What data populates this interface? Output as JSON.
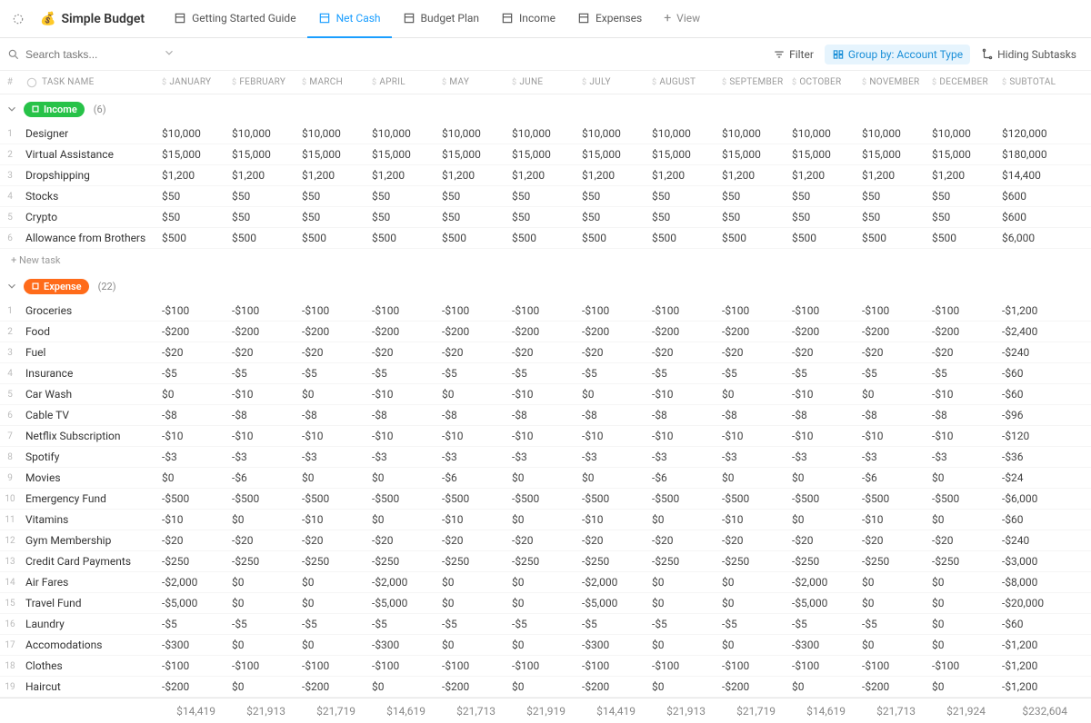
{
  "header": {
    "title": "Simple Budget",
    "emoji": "💰",
    "tabs": [
      {
        "label": "Getting Started Guide",
        "active": false
      },
      {
        "label": "Net Cash",
        "active": true
      },
      {
        "label": "Budget Plan",
        "active": false
      },
      {
        "label": "Income",
        "active": false
      },
      {
        "label": "Expenses",
        "active": false
      }
    ],
    "add_view_label": "View"
  },
  "toolbar": {
    "search_placeholder": "Search tasks...",
    "filter_label": "Filter",
    "group_label": "Group by: Account Type",
    "subtasks_label": "Hiding Subtasks"
  },
  "columns": {
    "index": "#",
    "name": "TASK NAME",
    "months": [
      "JANUARY",
      "FEBRUARY",
      "MARCH",
      "APRIL",
      "MAY",
      "JUNE",
      "JULY",
      "AUGUST",
      "SEPTEMBER",
      "OCTOBER",
      "NOVEMBER",
      "DECEMBER"
    ],
    "subtotal": "SUBTOTAL"
  },
  "groups": [
    {
      "name": "Income",
      "class": "income",
      "count": "(6)",
      "rows": [
        {
          "name": "Designer",
          "vals": [
            "$10,000",
            "$10,000",
            "$10,000",
            "$10,000",
            "$10,000",
            "$10,000",
            "$10,000",
            "$10,000",
            "$10,000",
            "$10,000",
            "$10,000",
            "$10,000"
          ],
          "sub": "$120,000"
        },
        {
          "name": "Virtual Assistance",
          "vals": [
            "$15,000",
            "$15,000",
            "$15,000",
            "$15,000",
            "$15,000",
            "$15,000",
            "$15,000",
            "$15,000",
            "$15,000",
            "$15,000",
            "$15,000",
            "$15,000"
          ],
          "sub": "$180,000"
        },
        {
          "name": "Dropshipping",
          "vals": [
            "$1,200",
            "$1,200",
            "$1,200",
            "$1,200",
            "$1,200",
            "$1,200",
            "$1,200",
            "$1,200",
            "$1,200",
            "$1,200",
            "$1,200",
            "$1,200"
          ],
          "sub": "$14,400"
        },
        {
          "name": "Stocks",
          "vals": [
            "$50",
            "$50",
            "$50",
            "$50",
            "$50",
            "$50",
            "$50",
            "$50",
            "$50",
            "$50",
            "$50",
            "$50"
          ],
          "sub": "$600"
        },
        {
          "name": "Crypto",
          "vals": [
            "$50",
            "$50",
            "$50",
            "$50",
            "$50",
            "$50",
            "$50",
            "$50",
            "$50",
            "$50",
            "$50",
            "$50"
          ],
          "sub": "$600"
        },
        {
          "name": "Allowance from Brothers",
          "vals": [
            "$500",
            "$500",
            "$500",
            "$500",
            "$500",
            "$500",
            "$500",
            "$500",
            "$500",
            "$500",
            "$500",
            "$500"
          ],
          "sub": "$6,000"
        }
      ]
    },
    {
      "name": "Expense",
      "class": "expense",
      "count": "(22)",
      "rows": [
        {
          "name": "Groceries",
          "vals": [
            "-$100",
            "-$100",
            "-$100",
            "-$100",
            "-$100",
            "-$100",
            "-$100",
            "-$100",
            "-$100",
            "-$100",
            "-$100",
            "-$100"
          ],
          "sub": "-$1,200"
        },
        {
          "name": "Food",
          "vals": [
            "-$200",
            "-$200",
            "-$200",
            "-$200",
            "-$200",
            "-$200",
            "-$200",
            "-$200",
            "-$200",
            "-$200",
            "-$200",
            "-$200"
          ],
          "sub": "-$2,400"
        },
        {
          "name": "Fuel",
          "vals": [
            "-$20",
            "-$20",
            "-$20",
            "-$20",
            "-$20",
            "-$20",
            "-$20",
            "-$20",
            "-$20",
            "-$20",
            "-$20",
            "-$20"
          ],
          "sub": "-$240"
        },
        {
          "name": "Insurance",
          "vals": [
            "-$5",
            "-$5",
            "-$5",
            "-$5",
            "-$5",
            "-$5",
            "-$5",
            "-$5",
            "-$5",
            "-$5",
            "-$5",
            "-$5"
          ],
          "sub": "-$60"
        },
        {
          "name": "Car Wash",
          "vals": [
            "$0",
            "-$10",
            "$0",
            "-$10",
            "$0",
            "-$10",
            "$0",
            "-$10",
            "$0",
            "-$10",
            "$0",
            "-$10"
          ],
          "sub": "-$60"
        },
        {
          "name": "Cable TV",
          "vals": [
            "-$8",
            "-$8",
            "-$8",
            "-$8",
            "-$8",
            "-$8",
            "-$8",
            "-$8",
            "-$8",
            "-$8",
            "-$8",
            "-$8"
          ],
          "sub": "-$96"
        },
        {
          "name": "Netflix Subscription",
          "vals": [
            "-$10",
            "-$10",
            "-$10",
            "-$10",
            "-$10",
            "-$10",
            "-$10",
            "-$10",
            "-$10",
            "-$10",
            "-$10",
            "-$10"
          ],
          "sub": "-$120"
        },
        {
          "name": "Spotify",
          "vals": [
            "-$3",
            "-$3",
            "-$3",
            "-$3",
            "-$3",
            "-$3",
            "-$3",
            "-$3",
            "-$3",
            "-$3",
            "-$3",
            "-$3"
          ],
          "sub": "-$36"
        },
        {
          "name": "Movies",
          "vals": [
            "$0",
            "-$6",
            "$0",
            "$0",
            "-$6",
            "$0",
            "$0",
            "-$6",
            "$0",
            "$0",
            "-$6",
            "$0"
          ],
          "sub": "-$24"
        },
        {
          "name": "Emergency Fund",
          "vals": [
            "-$500",
            "-$500",
            "-$500",
            "-$500",
            "-$500",
            "-$500",
            "-$500",
            "-$500",
            "-$500",
            "-$500",
            "-$500",
            "-$500"
          ],
          "sub": "-$6,000"
        },
        {
          "name": "Vitamins",
          "vals": [
            "-$10",
            "$0",
            "-$10",
            "$0",
            "-$10",
            "$0",
            "-$10",
            "$0",
            "-$10",
            "$0",
            "-$10",
            "$0"
          ],
          "sub": "-$60"
        },
        {
          "name": "Gym Membership",
          "vals": [
            "-$20",
            "-$20",
            "-$20",
            "-$20",
            "-$20",
            "-$20",
            "-$20",
            "-$20",
            "-$20",
            "-$20",
            "-$20",
            "-$20"
          ],
          "sub": "-$240"
        },
        {
          "name": "Credit Card Payments",
          "vals": [
            "-$250",
            "-$250",
            "-$250",
            "-$250",
            "-$250",
            "-$250",
            "-$250",
            "-$250",
            "-$250",
            "-$250",
            "-$250",
            "-$250"
          ],
          "sub": "-$3,000"
        },
        {
          "name": "Air Fares",
          "vals": [
            "-$2,000",
            "$0",
            "$0",
            "-$2,000",
            "$0",
            "$0",
            "-$2,000",
            "$0",
            "$0",
            "-$2,000",
            "$0",
            "$0"
          ],
          "sub": "-$8,000"
        },
        {
          "name": "Travel Fund",
          "vals": [
            "-$5,000",
            "$0",
            "$0",
            "-$5,000",
            "$0",
            "$0",
            "-$5,000",
            "$0",
            "$0",
            "-$5,000",
            "$0",
            "$0"
          ],
          "sub": "-$20,000"
        },
        {
          "name": "Laundry",
          "vals": [
            "-$5",
            "-$5",
            "-$5",
            "-$5",
            "-$5",
            "-$5",
            "-$5",
            "-$5",
            "-$5",
            "-$5",
            "-$5",
            "$0"
          ],
          "sub": "-$60"
        },
        {
          "name": "Accomodations",
          "vals": [
            "-$300",
            "$0",
            "$0",
            "-$300",
            "$0",
            "$0",
            "-$300",
            "$0",
            "$0",
            "-$300",
            "$0",
            "$0"
          ],
          "sub": "-$1,200"
        },
        {
          "name": "Clothes",
          "vals": [
            "-$100",
            "-$100",
            "-$100",
            "-$100",
            "-$100",
            "-$100",
            "-$100",
            "-$100",
            "-$100",
            "-$100",
            "-$100",
            "-$100"
          ],
          "sub": "-$1,200"
        },
        {
          "name": "Haircut",
          "vals": [
            "-$200",
            "$0",
            "-$200",
            "$0",
            "-$200",
            "$0",
            "-$200",
            "$0",
            "-$200",
            "$0",
            "-$200",
            "$0"
          ],
          "sub": "-$1,200"
        }
      ]
    }
  ],
  "new_task_label": "+ New task",
  "footer": {
    "months": [
      "$14,419",
      "$21,913",
      "$21,719",
      "$14,619",
      "$21,713",
      "$21,919",
      "$14,419",
      "$21,913",
      "$21,719",
      "$14,619",
      "$21,713",
      "$21,924"
    ],
    "subtotal": "$232,604"
  }
}
